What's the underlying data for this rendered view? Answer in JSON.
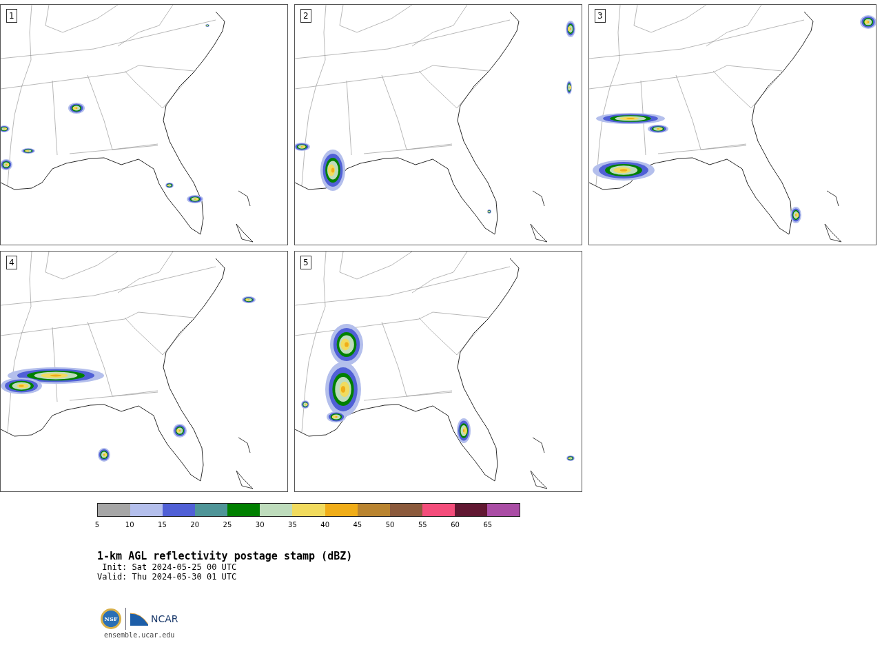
{
  "panels": [
    {
      "label": "1"
    },
    {
      "label": "2"
    },
    {
      "label": "3"
    },
    {
      "label": "4"
    },
    {
      "label": "5"
    }
  ],
  "colorbar": {
    "segments": [
      {
        "color": "#a6a6a6"
      },
      {
        "color": "#b4bfec"
      },
      {
        "color": "#5060d6"
      },
      {
        "color": "#4f9598"
      },
      {
        "color": "#008000"
      },
      {
        "color": "#bedcbc"
      },
      {
        "color": "#f1db5e"
      },
      {
        "color": "#f0ad18"
      },
      {
        "color": "#b98430"
      },
      {
        "color": "#8b5a3c"
      },
      {
        "color": "#f44d7b"
      },
      {
        "color": "#611832"
      },
      {
        "color": "#aa4da5"
      }
    ],
    "ticks": [
      "5",
      "10",
      "15",
      "20",
      "25",
      "30",
      "35",
      "40",
      "45",
      "50",
      "55",
      "60",
      "65"
    ]
  },
  "title": "1-km AGL reflectivity postage stamp (dBZ)",
  "init": "Init: Sat 2024-05-25 00 UTC",
  "valid": "Valid: Thu 2024-05-30 01 UTC",
  "logo": {
    "nsf": "NSF",
    "ncar": "NCAR",
    "url": "ensemble.ucar.edu"
  }
}
